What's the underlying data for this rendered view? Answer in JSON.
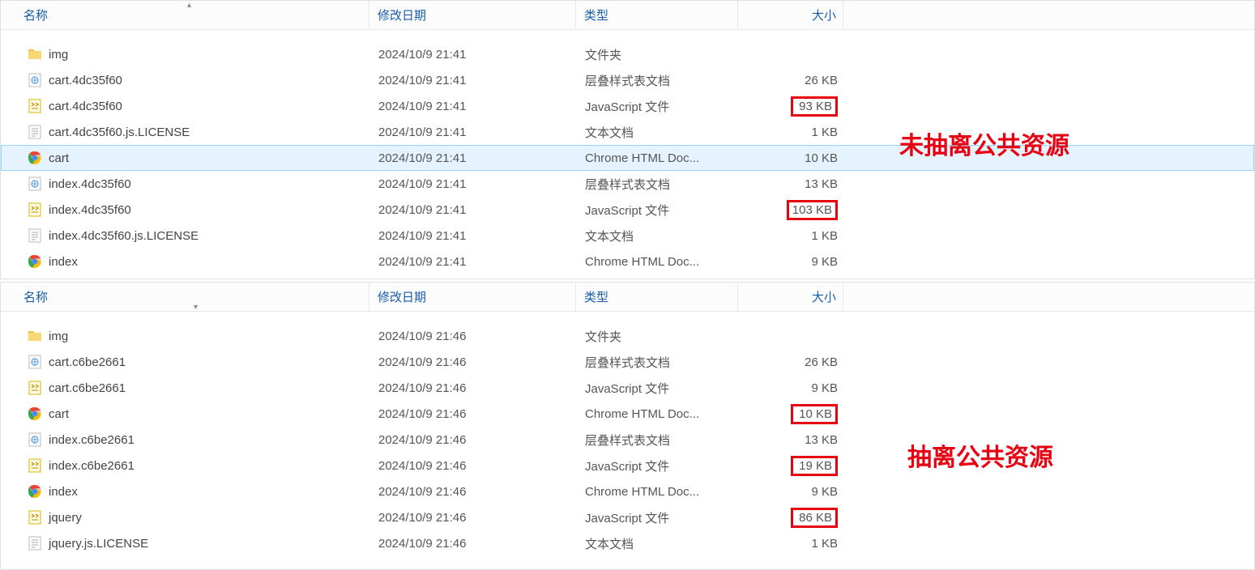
{
  "headers": {
    "name": "名称",
    "date": "修改日期",
    "type": "类型",
    "size": "大小"
  },
  "annotations": {
    "top": "未抽离公共资源",
    "bottom": "抽离公共资源"
  },
  "icons": {
    "folder": "folder-icon",
    "css": "css-file-icon",
    "js": "js-file-icon",
    "txt": "txt-file-icon",
    "chrome": "chrome-icon"
  },
  "panel_top": {
    "rows": [
      {
        "icon": "folder",
        "name": "img",
        "date": "2024/10/9 21:41",
        "type": "文件夹",
        "size": "",
        "boxed": false,
        "selected": false
      },
      {
        "icon": "css",
        "name": "cart.4dc35f60",
        "date": "2024/10/9 21:41",
        "type": "层叠样式表文档",
        "size": "26 KB",
        "boxed": false,
        "selected": false
      },
      {
        "icon": "js",
        "name": "cart.4dc35f60",
        "date": "2024/10/9 21:41",
        "type": "JavaScript 文件",
        "size": "93 KB",
        "boxed": true,
        "selected": false
      },
      {
        "icon": "txt",
        "name": "cart.4dc35f60.js.LICENSE",
        "date": "2024/10/9 21:41",
        "type": "文本文档",
        "size": "1 KB",
        "boxed": false,
        "selected": false
      },
      {
        "icon": "chrome",
        "name": "cart",
        "date": "2024/10/9 21:41",
        "type": "Chrome HTML Doc...",
        "size": "10 KB",
        "boxed": false,
        "selected": true
      },
      {
        "icon": "css",
        "name": "index.4dc35f60",
        "date": "2024/10/9 21:41",
        "type": "层叠样式表文档",
        "size": "13 KB",
        "boxed": false,
        "selected": false
      },
      {
        "icon": "js",
        "name": "index.4dc35f60",
        "date": "2024/10/9 21:41",
        "type": "JavaScript 文件",
        "size": "103 KB",
        "boxed": true,
        "selected": false
      },
      {
        "icon": "txt",
        "name": "index.4dc35f60.js.LICENSE",
        "date": "2024/10/9 21:41",
        "type": "文本文档",
        "size": "1 KB",
        "boxed": false,
        "selected": false
      },
      {
        "icon": "chrome",
        "name": "index",
        "date": "2024/10/9 21:41",
        "type": "Chrome HTML Doc...",
        "size": "9 KB",
        "boxed": false,
        "selected": false
      }
    ]
  },
  "panel_bottom": {
    "rows": [
      {
        "icon": "folder",
        "name": "img",
        "date": "2024/10/9 21:46",
        "type": "文件夹",
        "size": "",
        "boxed": false,
        "selected": false
      },
      {
        "icon": "css",
        "name": "cart.c6be2661",
        "date": "2024/10/9 21:46",
        "type": "层叠样式表文档",
        "size": "26 KB",
        "boxed": false,
        "selected": false
      },
      {
        "icon": "js",
        "name": "cart.c6be2661",
        "date": "2024/10/9 21:46",
        "type": "JavaScript 文件",
        "size": "9 KB",
        "boxed": false,
        "selected": false
      },
      {
        "icon": "chrome",
        "name": "cart",
        "date": "2024/10/9 21:46",
        "type": "Chrome HTML Doc...",
        "size": "10 KB",
        "boxed": true,
        "selected": false
      },
      {
        "icon": "css",
        "name": "index.c6be2661",
        "date": "2024/10/9 21:46",
        "type": "层叠样式表文档",
        "size": "13 KB",
        "boxed": false,
        "selected": false
      },
      {
        "icon": "js",
        "name": "index.c6be2661",
        "date": "2024/10/9 21:46",
        "type": "JavaScript 文件",
        "size": "19 KB",
        "boxed": true,
        "selected": false
      },
      {
        "icon": "chrome",
        "name": "index",
        "date": "2024/10/9 21:46",
        "type": "Chrome HTML Doc...",
        "size": "9 KB",
        "boxed": false,
        "selected": false
      },
      {
        "icon": "js",
        "name": "jquery",
        "date": "2024/10/9 21:46",
        "type": "JavaScript 文件",
        "size": "86 KB",
        "boxed": true,
        "selected": false
      },
      {
        "icon": "txt",
        "name": "jquery.js.LICENSE",
        "date": "2024/10/9 21:46",
        "type": "文本文档",
        "size": "1 KB",
        "boxed": false,
        "selected": false
      }
    ]
  }
}
